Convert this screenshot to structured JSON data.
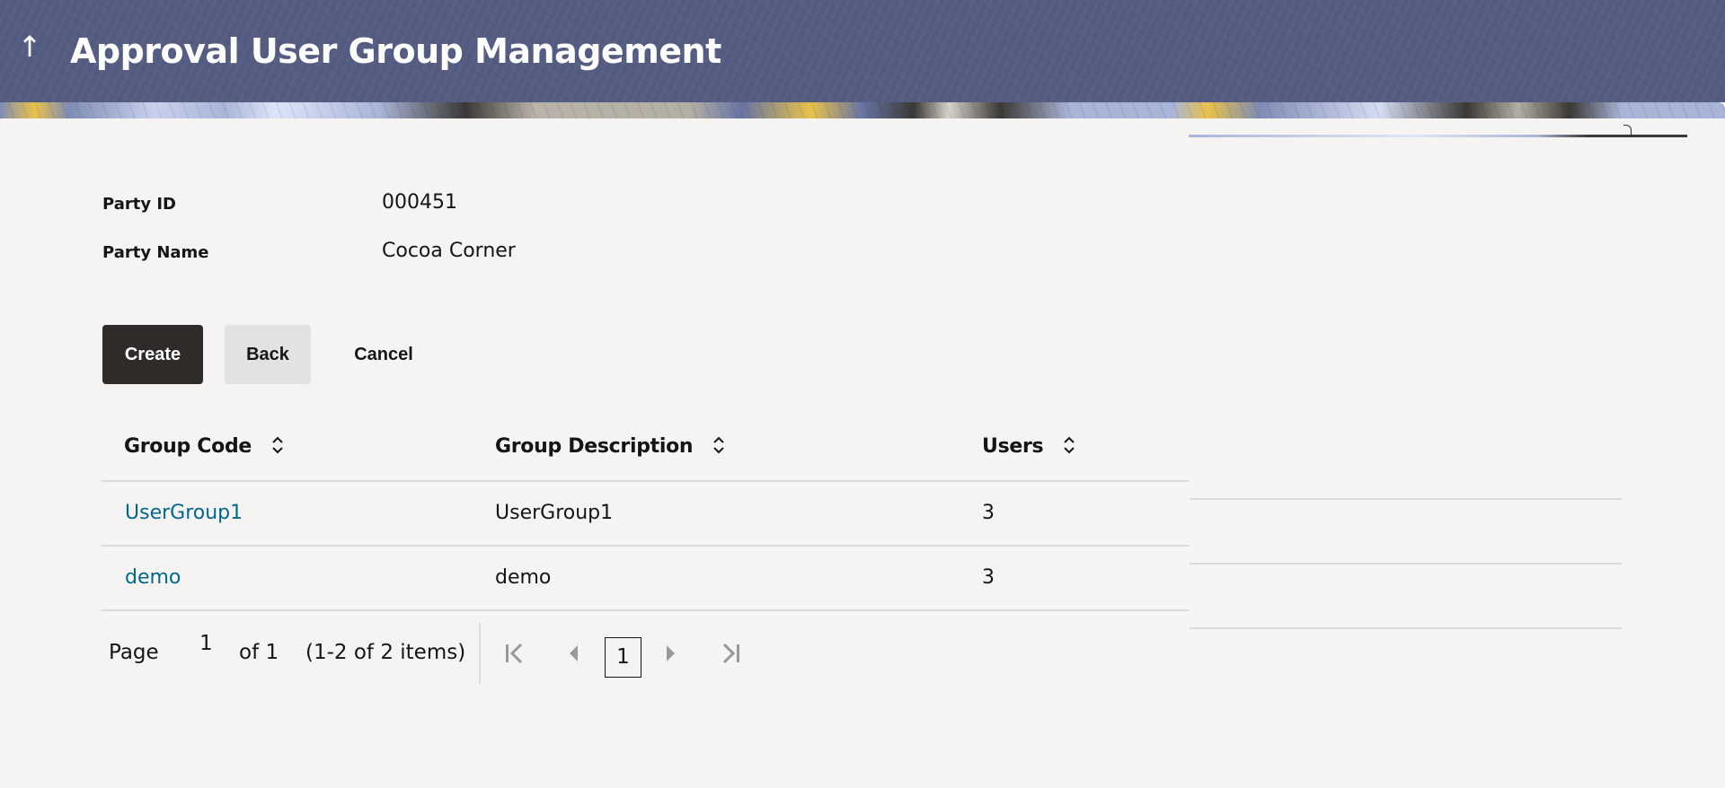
{
  "header": {
    "title": "Approval User Group Management",
    "back_icon": "arrow-up-icon"
  },
  "party": {
    "id_label": "Party ID",
    "id_value": "000451",
    "name_label": "Party Name",
    "name_value": "Cocoa Corner"
  },
  "actions": {
    "create_label": "Create",
    "back_label": "Back",
    "cancel_label": "Cancel"
  },
  "table": {
    "columns": [
      {
        "label": "Group Code",
        "sort_icon": "sort-updown-icon"
      },
      {
        "label": "Group Description",
        "sort_icon": "sort-updown-icon"
      },
      {
        "label": "Users",
        "sort_icon": "sort-updown-icon"
      }
    ],
    "rows": [
      {
        "code": "UserGroup1",
        "description": "UserGroup1",
        "users": "3"
      },
      {
        "code": "demo",
        "description": "demo",
        "users": "3"
      }
    ]
  },
  "pagination": {
    "page_label": "Page",
    "current_page": "1",
    "of_label": "of 1",
    "items_summary": "(1-2 of 2 items)",
    "page_button": "1",
    "icons": [
      "first-page-icon",
      "previous-page-icon",
      "next-page-icon",
      "last-page-icon"
    ]
  },
  "colors": {
    "header_bg": "#555c82",
    "link": "#00688c",
    "primary_button": "#2e2b28",
    "secondary_button": "#e3e2e0",
    "page_bg": "#f5f4f2"
  }
}
